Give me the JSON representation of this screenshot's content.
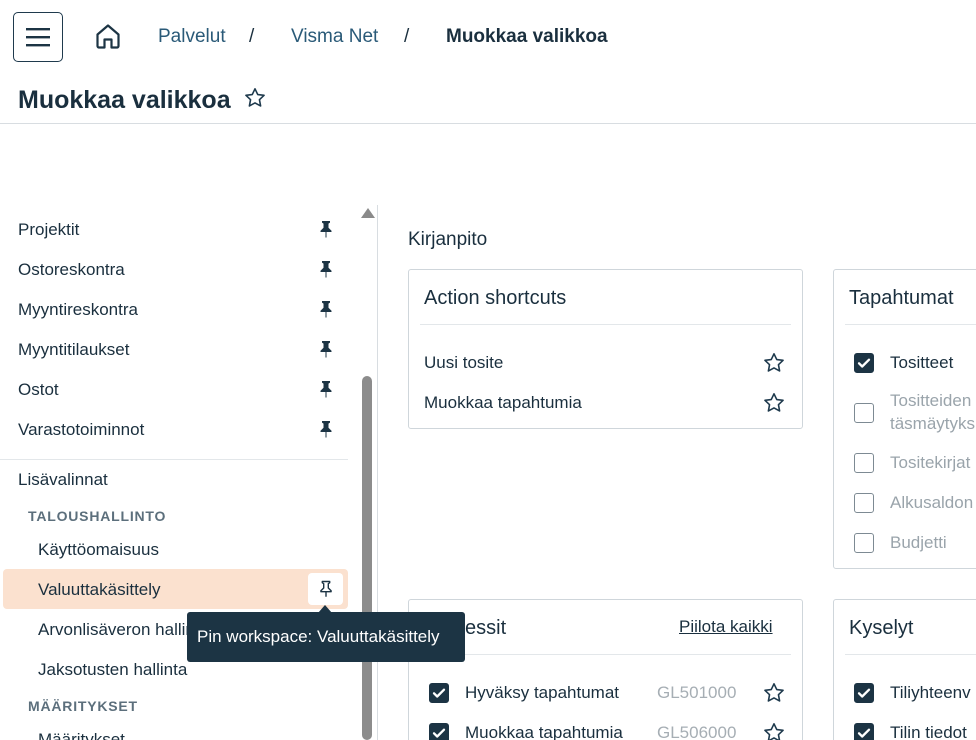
{
  "header": {
    "breadcrumb": [
      "Palvelut",
      "Visma Net",
      "Muokkaa valikkoa"
    ],
    "separator": "/",
    "page_title": "Muokkaa valikkoa"
  },
  "sidebar": {
    "pinned_items": [
      "Projektit",
      "Ostoreskontra",
      "Myyntireskontra",
      "Myyntitilaukset",
      "Ostot",
      "Varastotoiminnot"
    ],
    "group_title": "Lisävalinnat",
    "categories": [
      {
        "name": "TALOUSHALLINTO",
        "items": [
          "Käyttöomaisuus",
          "Valuuttakäsittely",
          "Arvonlisäveron hallinta",
          "Jaksotusten hallinta"
        ]
      },
      {
        "name": "MÄÄRITYKSET",
        "items": [
          "Määritykset"
        ]
      }
    ],
    "hovered_item": "Valuuttakäsittely"
  },
  "tooltip": {
    "text": "Pin workspace: Valuuttakäsittely"
  },
  "main": {
    "section_title": "Kirjanpito",
    "cards": {
      "action_shortcuts": {
        "title": "Action shortcuts",
        "rows": [
          "Uusi tosite",
          "Muokkaa tapahtumia"
        ]
      },
      "tapahtumat": {
        "title": "Tapahtumat",
        "rows": [
          {
            "label": "Tositteet",
            "checked": true
          },
          {
            "label": "Tositteiden",
            "label2": "täsmäytyks",
            "checked": false
          },
          {
            "label": "Tositekirjat",
            "checked": false
          },
          {
            "label": "Alkusaldon",
            "checked": false
          },
          {
            "label": "Budjetti",
            "checked": false
          }
        ]
      },
      "prosessit": {
        "title": "essit",
        "hide_all": "Piilota kaikki",
        "rows": [
          {
            "label": "Hyväksy tapahtumat",
            "code": "GL501000",
            "checked": true
          },
          {
            "label": "Muokkaa tapahtumia",
            "code": "GL506000",
            "checked": true
          }
        ]
      },
      "kyselyt": {
        "title": "Kyselyt",
        "rows": [
          {
            "label": "Tiliyhteenv",
            "checked": true
          },
          {
            "label": "Tilin tiedot",
            "checked": true
          }
        ]
      }
    }
  },
  "colors": {
    "accent_dark": "#1c3444",
    "highlight": "#fbe1cf",
    "text": "#1a2f3e"
  },
  "icons": [
    "menu-icon",
    "home-icon",
    "star-icon",
    "pin-icon",
    "pin-outline-icon",
    "checkbox-checked-icon",
    "checkbox-empty-icon",
    "scroll-up-icon"
  ]
}
